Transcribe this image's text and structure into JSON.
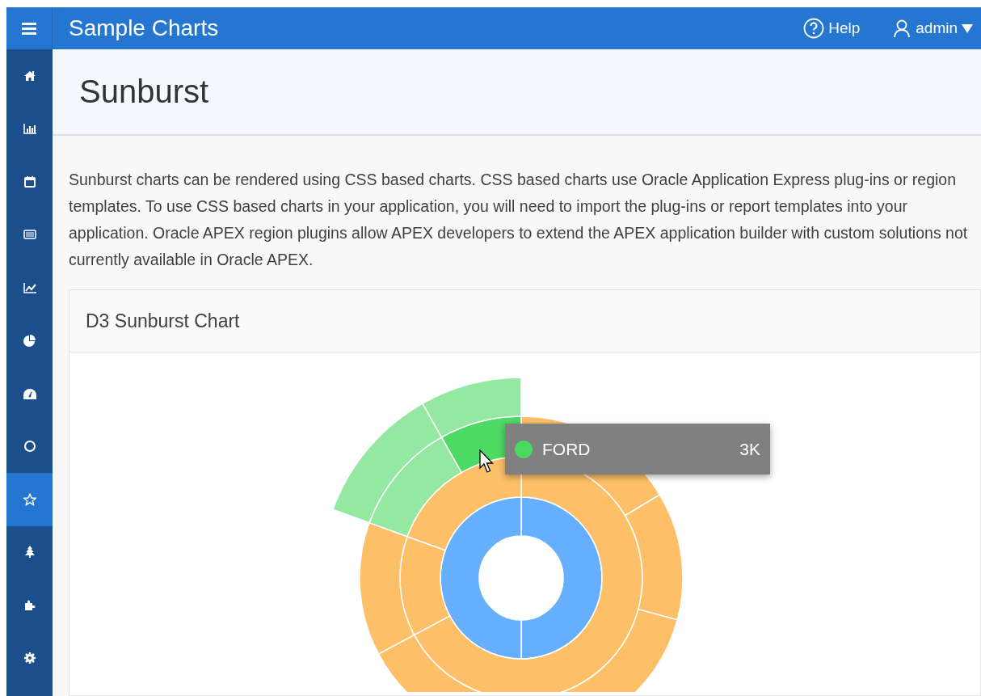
{
  "header": {
    "title": "Sample Charts",
    "help": "Help",
    "user": "admin"
  },
  "sidebar": {
    "items": [
      {
        "selected": false
      },
      {
        "selected": false
      },
      {
        "selected": false
      },
      {
        "selected": false
      },
      {
        "selected": false
      },
      {
        "selected": false
      },
      {
        "selected": false
      },
      {
        "selected": false
      },
      {
        "selected": true
      },
      {
        "selected": false
      },
      {
        "selected": false
      },
      {
        "selected": false
      }
    ]
  },
  "page": {
    "title": "Sunburst",
    "description": "Sunburst charts can be rendered using CSS based charts. CSS based charts use Oracle Application Express plug-ins or region templates. To use CSS based charts in your application, you will need to import the plug-ins or report templates into your application. Oracle APEX region plugins allow APEX developers to extend the APEX application builder with custom solutions not currently available in Oracle APEX."
  },
  "region": {
    "title": "D3 Sunburst Chart",
    "tooltip": {
      "label": "FORD",
      "value": "3K",
      "color": "#4cd964"
    }
  }
}
